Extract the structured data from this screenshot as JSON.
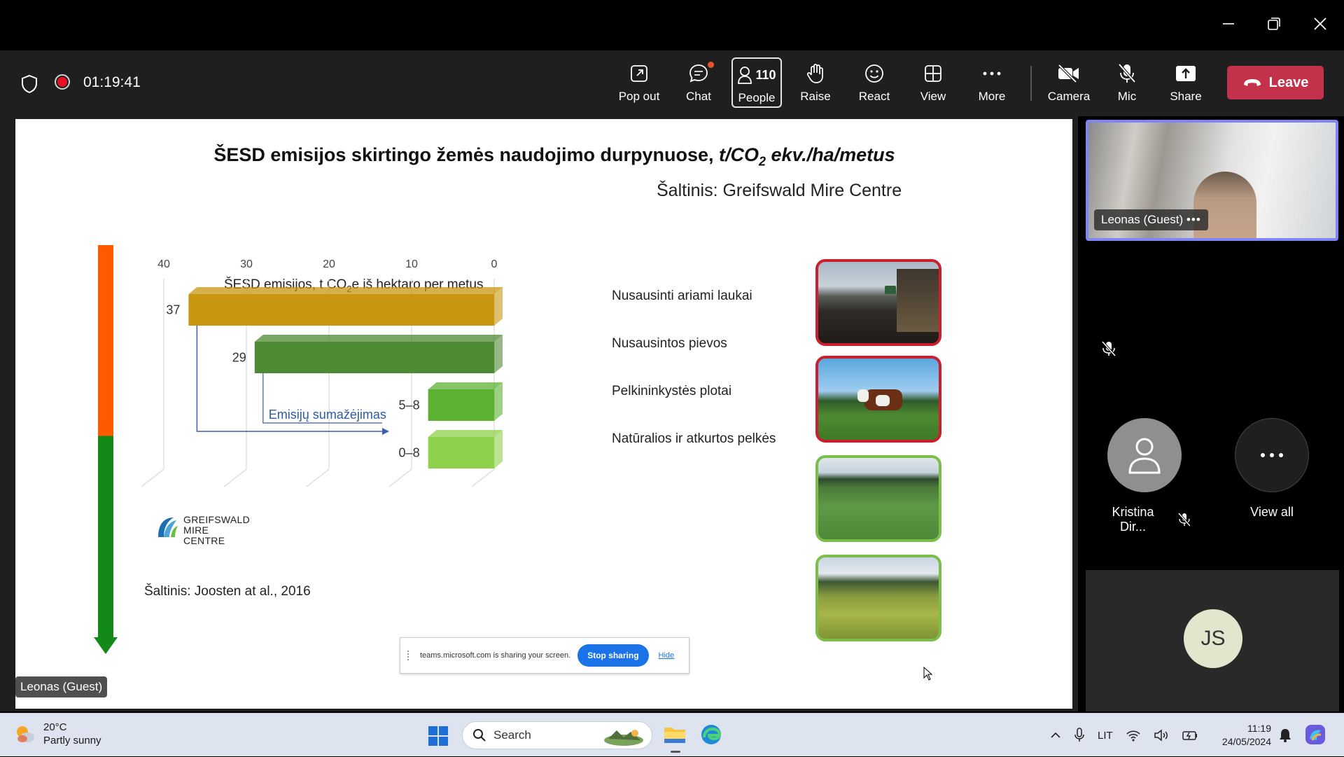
{
  "window": {
    "minimize_icon": "minimize-icon",
    "restore_icon": "restore-icon",
    "close_icon": "close-icon"
  },
  "toolbar": {
    "timer": "01:19:41",
    "buttons": {
      "pop_out": "Pop out",
      "chat": "Chat",
      "people": "People",
      "people_count": "110",
      "raise": "Raise",
      "react": "React",
      "view": "View",
      "more": "More",
      "camera": "Camera",
      "mic": "Mic",
      "share": "Share",
      "leave": "Leave"
    },
    "leave_color": "#c4314b"
  },
  "slide": {
    "title_plain": "ŠESD emisijos skirtingo žemės naudojimo durpynuose, ",
    "title_italic_a": "t/CO",
    "title_italic_sub": "2",
    "title_italic_b": " ekv./ha/metus",
    "source": "Šaltinis: Greifswald Mire Centre",
    "reference": "Šaltinis: Joosten at al., 2016",
    "logo_lines": [
      "GREIFSWALD",
      "MIRE",
      "CENTRE"
    ],
    "photos": [
      "tractor-on-drained-field",
      "cow-on-pasture",
      "paludiculture-reeds",
      "natural-bog"
    ]
  },
  "chart_data": {
    "type": "bar",
    "orientation": "horizontal-reversed",
    "title_a": "ŠESD emisijos, t CO",
    "title_sub": "2",
    "title_b": "e iš hektaro per metus",
    "xlim": [
      40,
      0
    ],
    "ticks": [
      "40",
      "30",
      "20",
      "10",
      "0"
    ],
    "categories": [
      "Nusausinti ariami laukai",
      "Nusausintos pievos",
      "Pelkininkystės plotai",
      "Natūralios ir atkurtos pelkės"
    ],
    "values": [
      37,
      29,
      8,
      8
    ],
    "value_labels": [
      "37",
      "29",
      "5–8",
      "0–8"
    ],
    "colors": [
      "#c8960f",
      "#4e8a33",
      "#5cb133",
      "#8dd24a"
    ],
    "annotation": "Emisijų sumažėjimas",
    "scale_arrow": {
      "top_color": "#ff5a00",
      "bottom_color": "#138a18"
    }
  },
  "share_banner": {
    "message": "teams.microsoft.com is sharing your screen.",
    "stop_label": "Stop sharing",
    "hide_label": "Hide"
  },
  "presenter_label": "Leonas (Guest)",
  "participants": {
    "leonas_label": "Leonas (Guest)",
    "kristina_name": "Kristina Dir...",
    "view_all": "View all",
    "js_initials": "JS"
  },
  "taskbar": {
    "temperature": "20°C",
    "weather": "Partly sunny",
    "search_placeholder": "Search",
    "language": "LIT",
    "time": "11:19",
    "date": "24/05/2024"
  }
}
